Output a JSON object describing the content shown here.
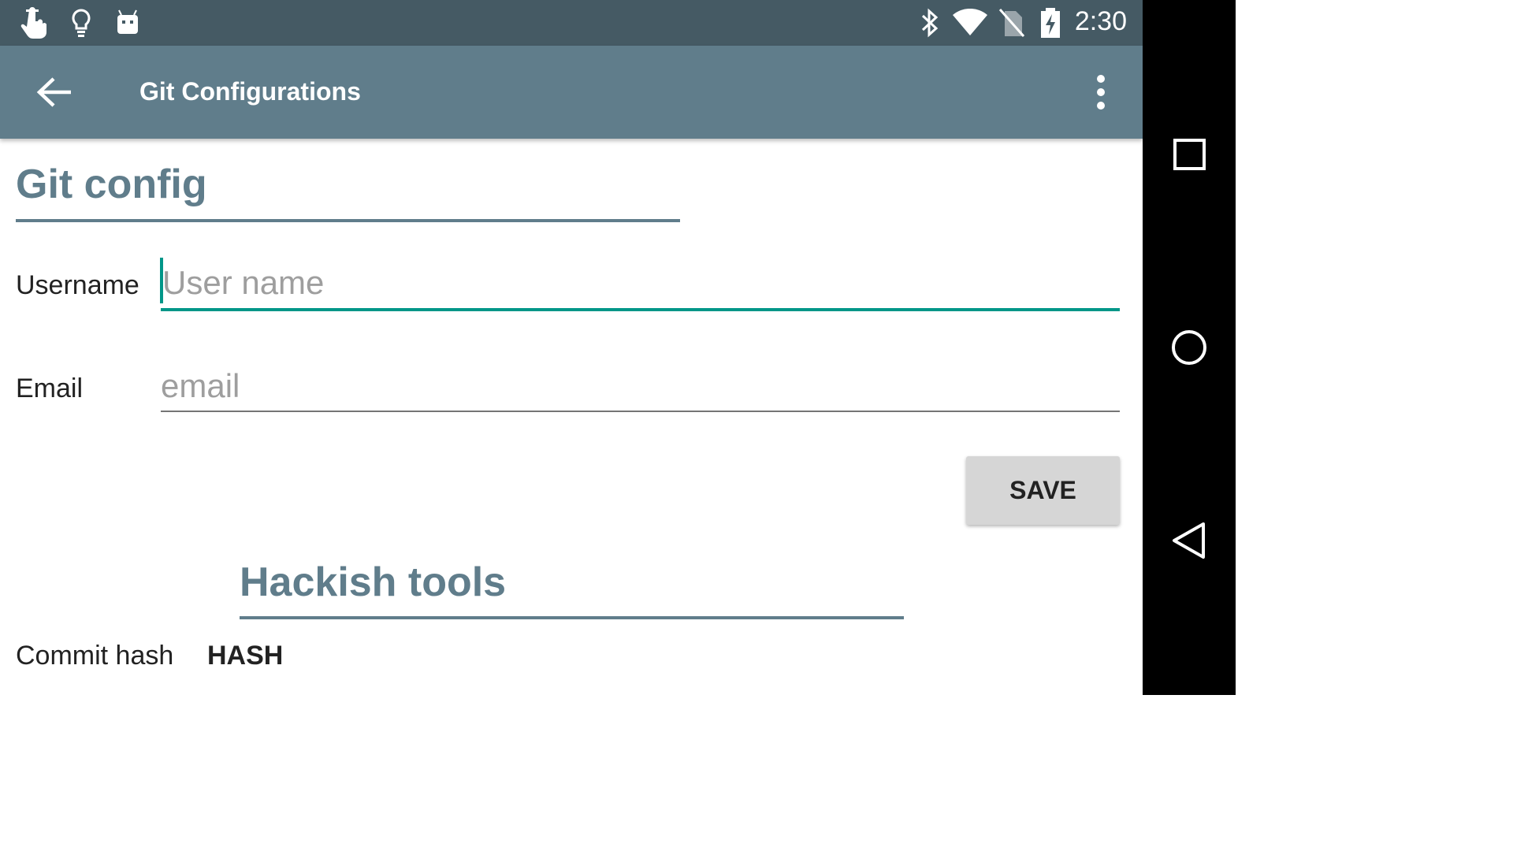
{
  "status_bar": {
    "time": "2:30",
    "left_icons": [
      "touch-hand-icon",
      "lightbulb-icon",
      "android-robot-icon"
    ],
    "right_icons": [
      "bluetooth-icon",
      "wifi-icon",
      "no-sim-icon",
      "battery-charging-icon"
    ]
  },
  "toolbar": {
    "title": "Git Configurations",
    "back_icon": "arrow-back-icon",
    "overflow_icon": "more-vert-icon"
  },
  "git_config": {
    "title": "Git config",
    "username_label": "Username",
    "username_placeholder": "User name",
    "username_value": "",
    "email_label": "Email",
    "email_placeholder": "email",
    "email_value": "",
    "save_label": "SAVE"
  },
  "hackish_tools": {
    "title": "Hackish tools",
    "commit_hash_label": "Commit hash",
    "commit_hash_value": "HASH"
  },
  "nav_bar": {
    "buttons": [
      "recents-square-icon",
      "home-circle-icon",
      "back-triangle-icon"
    ]
  },
  "colors": {
    "status_bar": "#455a64",
    "toolbar": "#607d8b",
    "accent": "#009688",
    "section_title": "#607d8b"
  }
}
